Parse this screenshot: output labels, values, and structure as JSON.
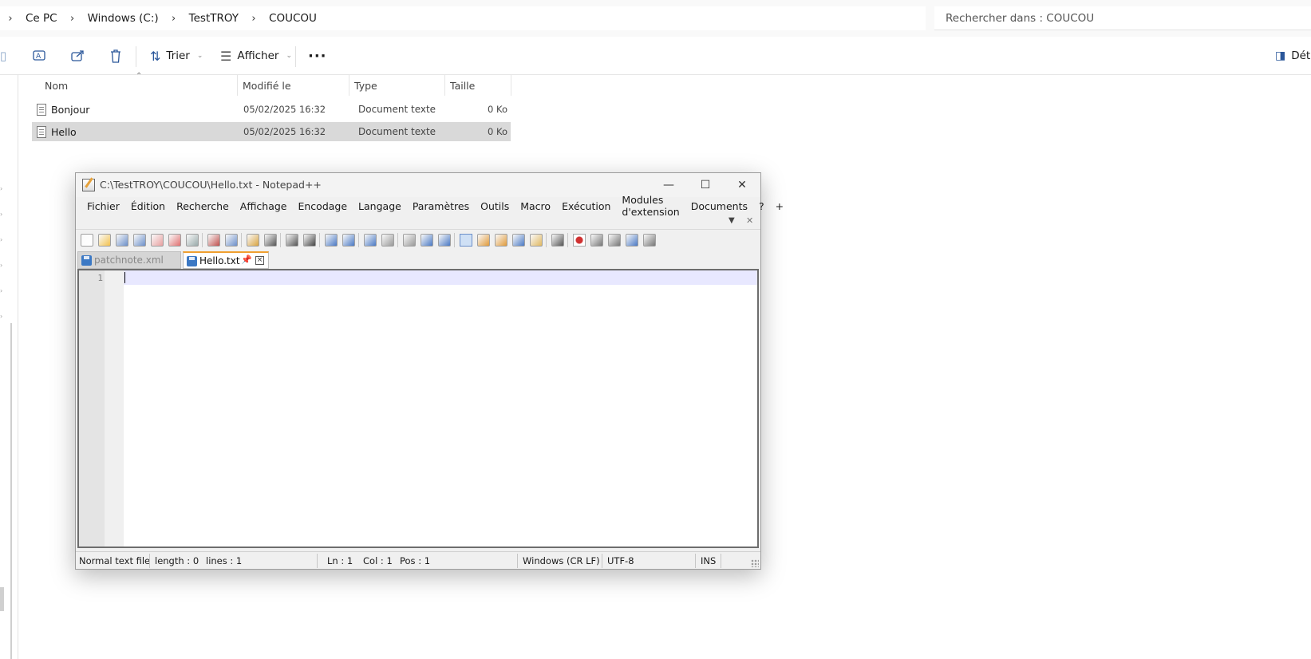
{
  "explorer": {
    "breadcrumb": [
      "Ce PC",
      "Windows (C:)",
      "TestTROY",
      "COUCOU"
    ],
    "search_placeholder": "Rechercher dans : COUCOU",
    "toolbar": {
      "sort_label": "Trier",
      "view_label": "Afficher",
      "more_label": "···",
      "details_label": "Déta"
    },
    "columns": [
      "Nom",
      "Modifié le",
      "Type",
      "Taille"
    ],
    "files": [
      {
        "name": "Bonjour",
        "modified": "05/02/2025 16:32",
        "type": "Document texte",
        "size": "0 Ko",
        "selected": false
      },
      {
        "name": "Hello",
        "modified": "05/02/2025 16:32",
        "type": "Document texte",
        "size": "0 Ko",
        "selected": true
      }
    ]
  },
  "notepad": {
    "title": "C:\\TestTROY\\COUCOU\\Hello.txt - Notepad++",
    "window_controls": {
      "minimize": "—",
      "maximize": "☐",
      "close": "✕"
    },
    "menu": [
      "Fichier",
      "Édition",
      "Recherche",
      "Affichage",
      "Encodage",
      "Langage",
      "Paramètres",
      "Outils",
      "Macro",
      "Exécution",
      "Modules d'extension",
      "Documents",
      "?"
    ],
    "menu_plus": "+",
    "menu_down": "▼",
    "menu_close": "✕",
    "tabs": [
      {
        "label": "patchnote.xml",
        "active": false
      },
      {
        "label": "Hello.txt",
        "active": true
      }
    ],
    "tab_pin": "📌",
    "tab_close": "×",
    "editor": {
      "line_numbers": [
        "1"
      ]
    },
    "status": {
      "file_type": "Normal text file",
      "length": "length : 0",
      "lines": "lines : 1",
      "ln": "Ln : 1",
      "col": "Col : 1",
      "pos": "Pos : 1",
      "eol": "Windows (CR LF)",
      "encoding": "UTF-8",
      "mode": "INS"
    },
    "toolbar_icons": [
      "new-file",
      "open-file",
      "save",
      "save-all",
      "close",
      "close-all",
      "print",
      "cut",
      "copy",
      "paste",
      "undo",
      "redo",
      "find",
      "replace",
      "zoom-in",
      "zoom-out",
      "sync-v",
      "sync-h",
      "word-wrap",
      "all-chars",
      "indent-guide",
      "lang-udl",
      "doc-map",
      "func-list",
      "folder-workspace",
      "monitoring",
      "macro-record",
      "macro-stop",
      "macro-play",
      "macro-run-multiple",
      "macro-save"
    ]
  },
  "colors": {
    "accent": "#2b579a",
    "selection": "#d9d9d9",
    "current_line": "#e8e8ff",
    "tab_active_marker": "#f0a030"
  }
}
